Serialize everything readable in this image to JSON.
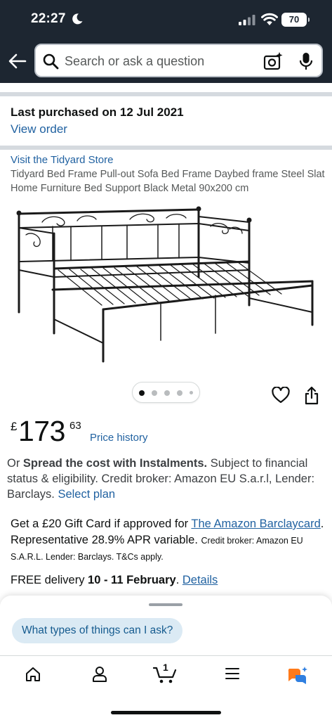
{
  "status_bar": {
    "time": "22:27",
    "battery": "70"
  },
  "search": {
    "placeholder": "Search or ask a question"
  },
  "purchase": {
    "last_purchased": "Last purchased on 12 Jul 2021",
    "view_order": "View order"
  },
  "product": {
    "store_link": "Visit the Tidyard Store",
    "title": "Tidyard Bed Frame Pull-out Sofa Bed Frame Daybed frame Steel Slat Home Furniture Bed Support Black Metal 90x200 cm",
    "image_count": 5,
    "active_image": 1
  },
  "price": {
    "currency": "£",
    "whole": "173",
    "fraction": "63",
    "history": "Price history"
  },
  "instalments": {
    "prefix": "Or ",
    "bold": "Spread the cost with Instalments.",
    "text": " Subject to financial status & eligibility. Credit broker: Amazon EU S.a.r.l, Lender: Barclays. ",
    "link": "Select plan"
  },
  "giftcard": {
    "prefix": "Get a £20 Gift Card if approved for ",
    "link": "The Amazon Barclaycard",
    "middle": ". Representative 28.9% APR variable. ",
    "small": "Credit broker: Amazon EU S.A.R.L. Lender: Barclays. T&Cs apply."
  },
  "delivery": {
    "prefix": "FREE delivery ",
    "dates": "10 - 11 February",
    "sep": ". ",
    "link": "Details"
  },
  "assistant": {
    "chip": "What types of things can I ask?"
  },
  "tabbar": {
    "cart_count": "1"
  },
  "colors": {
    "header_bg": "#1d2631",
    "link": "#2162a1",
    "chip_bg": "#dbeaf4",
    "rufus_orange": "#ff7a1a",
    "rufus_blue": "#2f7fe0"
  }
}
